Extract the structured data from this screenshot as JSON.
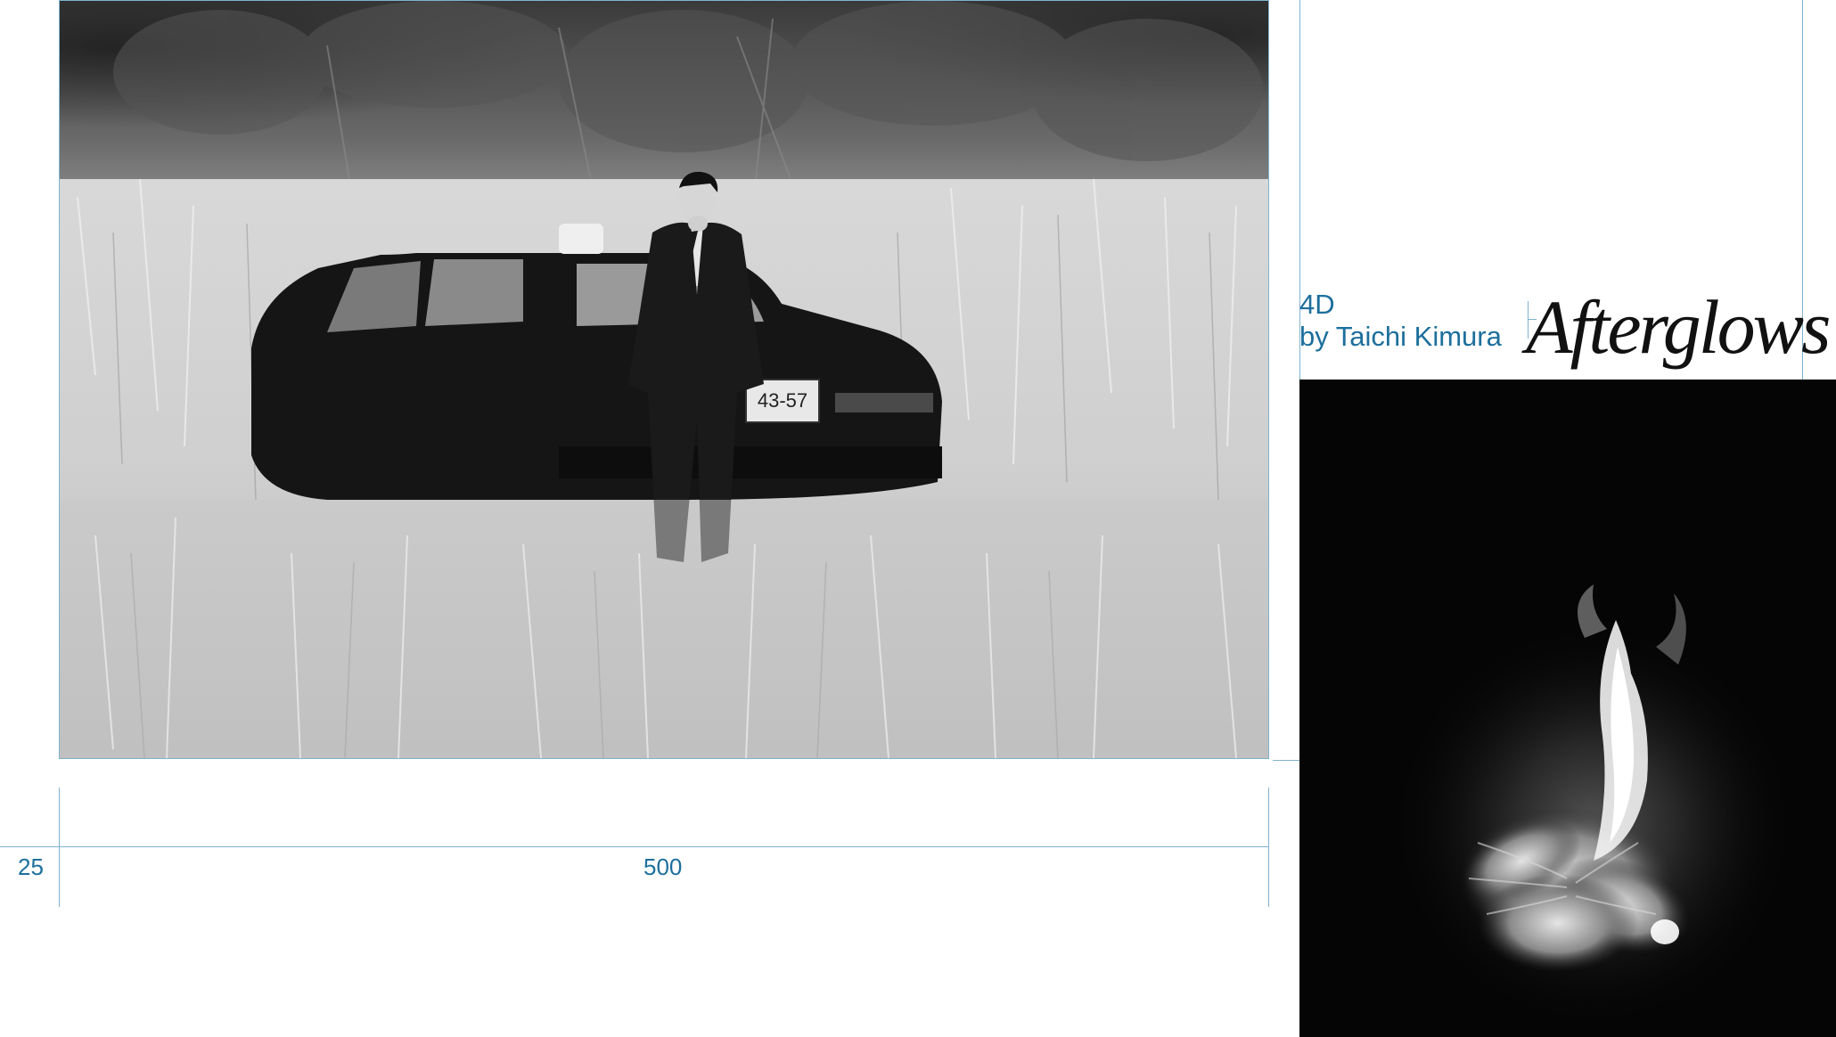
{
  "title_block": {
    "code": "4D",
    "author": "by Taichi Kimura",
    "title": "Afterglows"
  },
  "measurements": {
    "margin_label": "25",
    "width_label": "500"
  },
  "images": {
    "main_photo": "Man in dark suit smoking beside a black taxi in a field of tall grass, black and white",
    "flame_photo": "Burning white flower against black background"
  },
  "colors": {
    "guide": "#7fb3cf",
    "text_accent": "#1d6f9c",
    "title": "#111111"
  }
}
